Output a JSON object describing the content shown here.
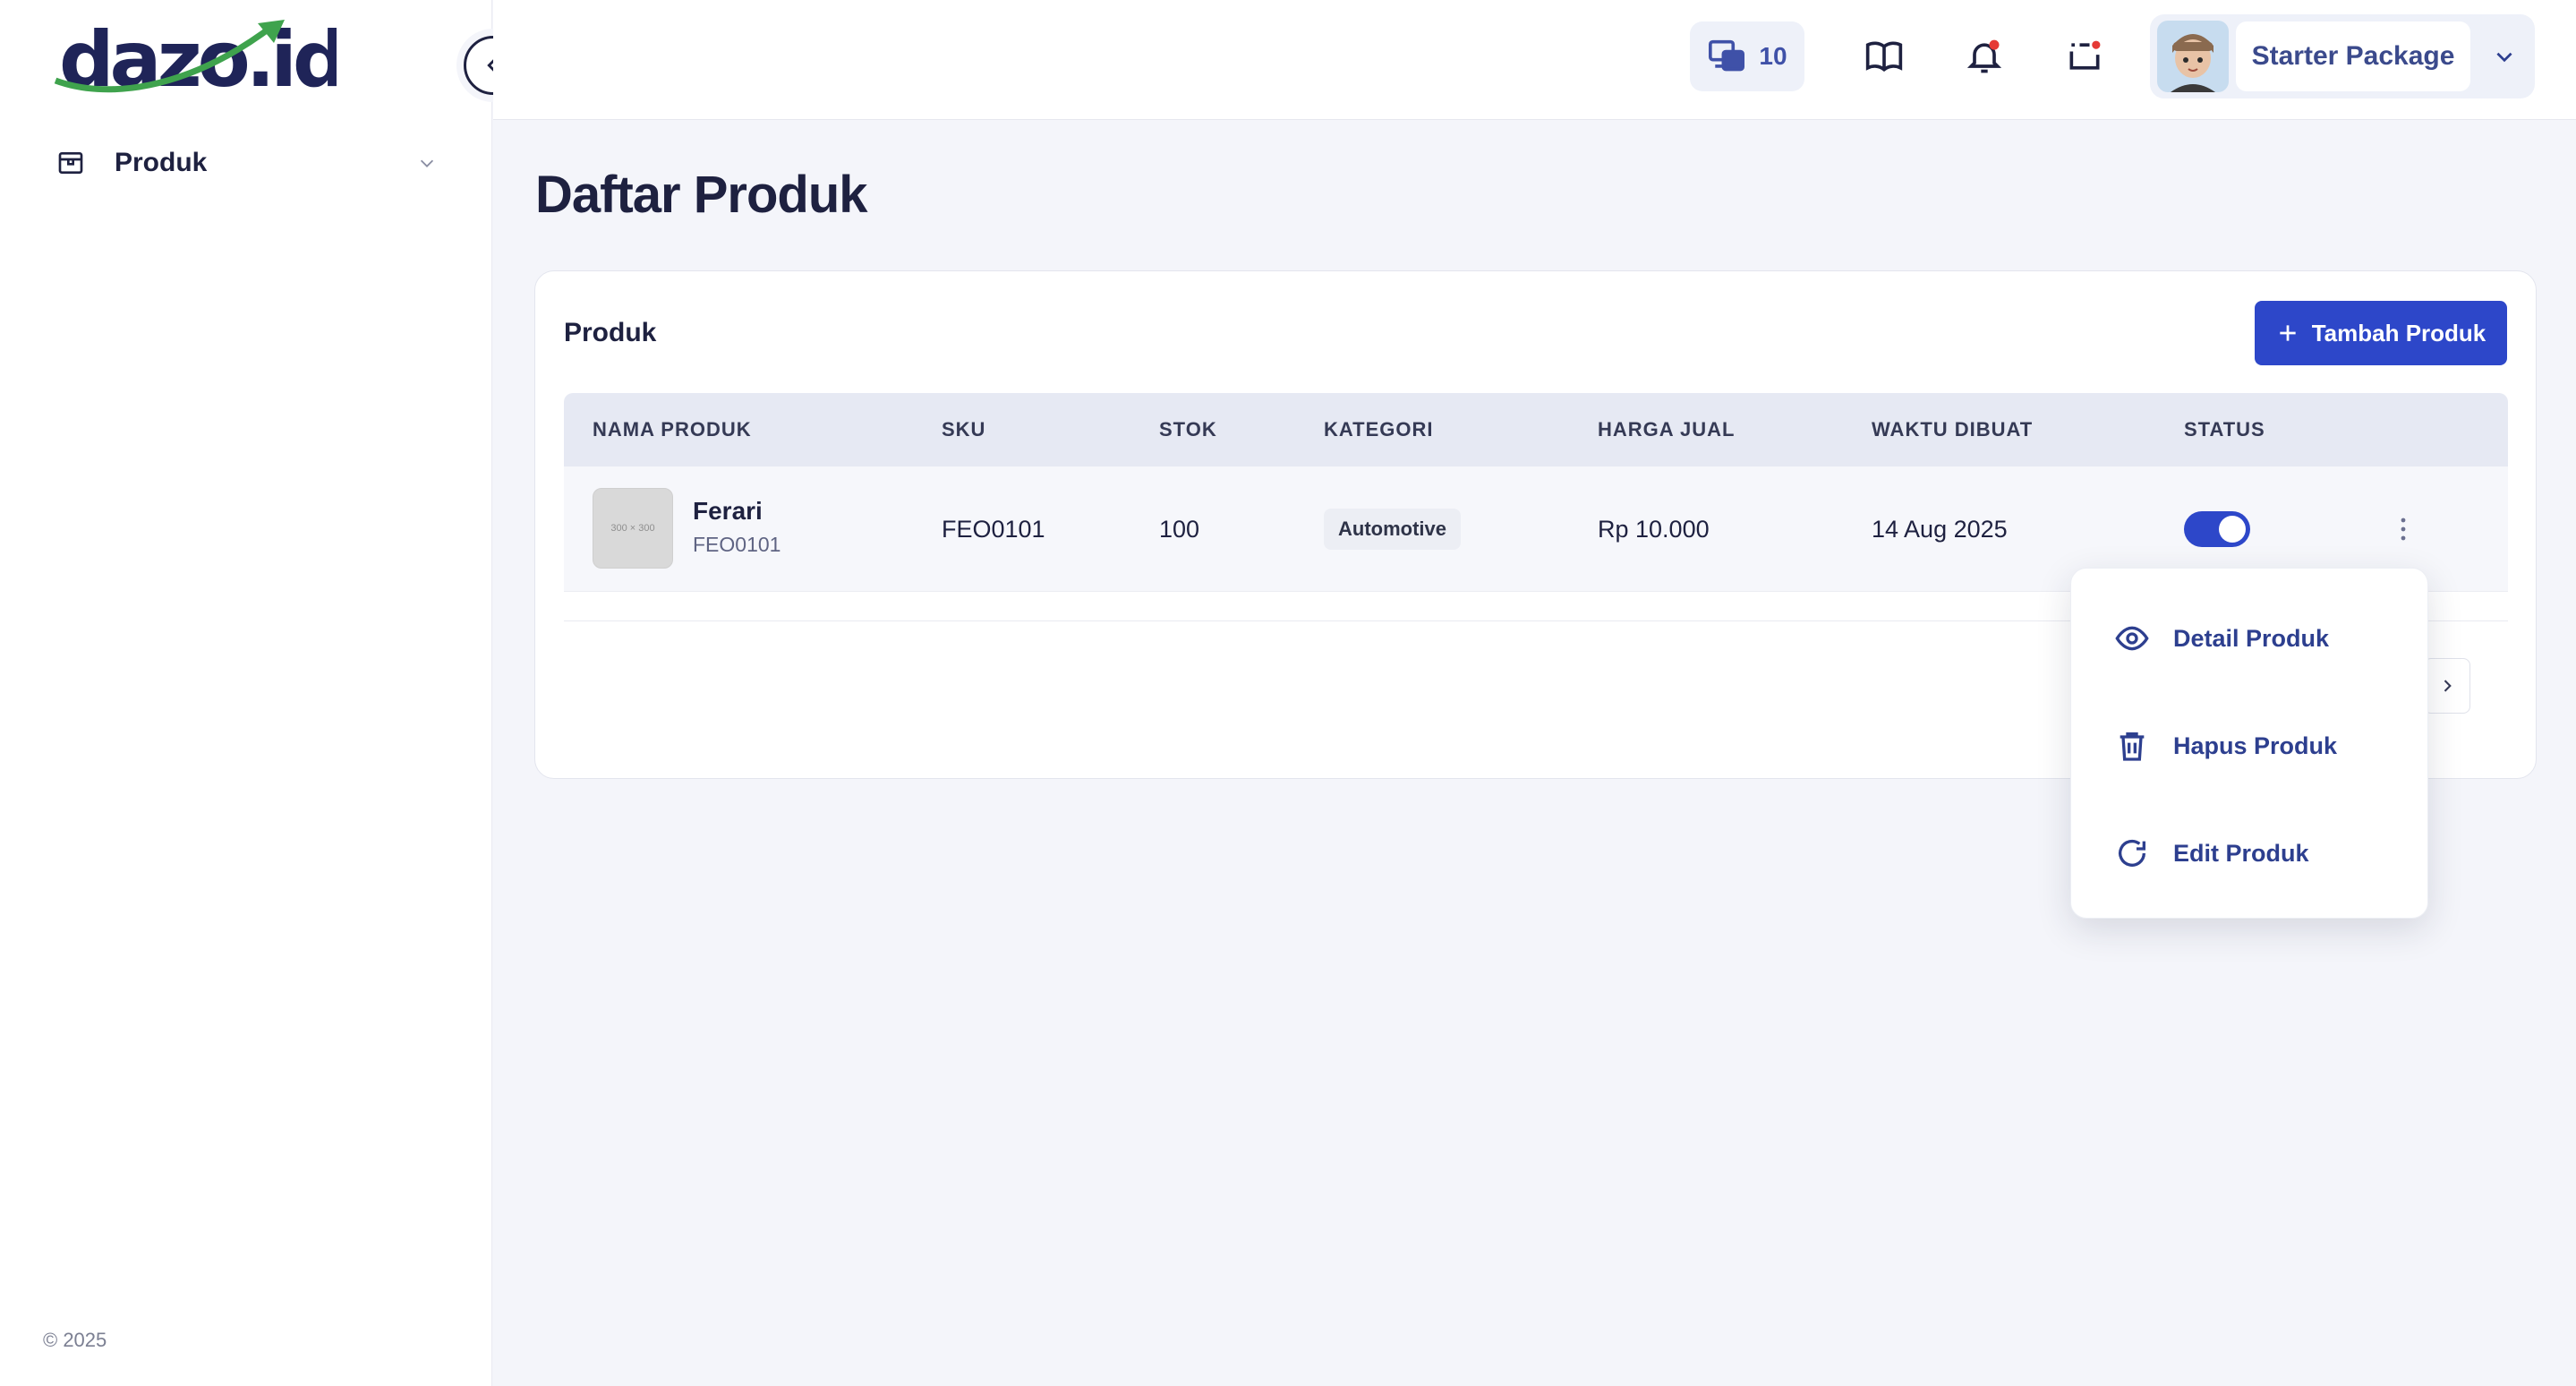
{
  "brand": {
    "logo_text": "dazo.id"
  },
  "sidebar": {
    "items": [
      {
        "label": "Produk",
        "icon": "box-icon"
      }
    ],
    "copyright": "© 2025"
  },
  "header": {
    "credits_count": "10",
    "package_name": "Starter Package",
    "icons": [
      "devices-icon",
      "book-icon",
      "bell-icon",
      "route-icon",
      "chevron-down-icon"
    ]
  },
  "main": {
    "page_title": "Daftar Produk",
    "card_title": "Produk",
    "add_button": "Tambah Produk",
    "columns": [
      "NAMA PRODUK",
      "SKU",
      "STOK",
      "KATEGORI",
      "HARGA JUAL",
      "WAKTU DIBUAT",
      "STATUS"
    ],
    "rows": [
      {
        "thumb": "300 × 300",
        "name": "Ferari",
        "sku_sub": "FEO0101",
        "sku": "FEO0101",
        "stock": "100",
        "category": "Automotive",
        "price": "Rp 10.000",
        "created": "14 Aug 2025",
        "status_active": true
      }
    ]
  },
  "menu": {
    "items": [
      {
        "label": "Detail Produk",
        "icon": "eye-icon"
      },
      {
        "label": "Hapus Produk",
        "icon": "trash-icon"
      },
      {
        "label": "Edit Produk",
        "icon": "refresh-icon"
      }
    ]
  },
  "colors": {
    "primary": "#2d47c9",
    "text": "#1e2140",
    "accent_green": "#3fa34d",
    "badge_red": "#e53935"
  }
}
